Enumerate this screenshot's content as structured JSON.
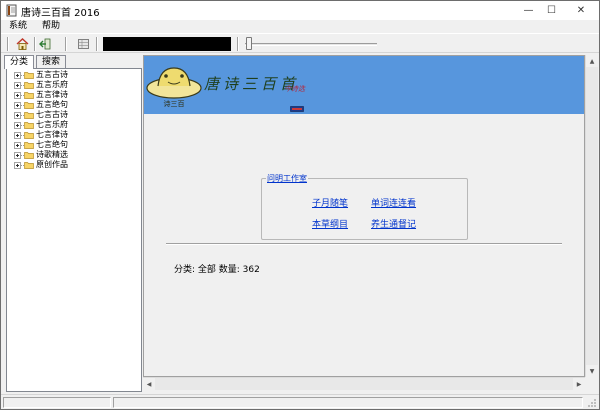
{
  "window": {
    "title": "唐诗三百首 2016",
    "minimize_glyph": "—",
    "maximize_glyph": "☐",
    "close_glyph": "✕"
  },
  "menu": {
    "items": [
      "系统",
      "帮助"
    ]
  },
  "toolbar": {
    "buttons": [
      "home-icon",
      "exit-icon",
      "grid-icon"
    ]
  },
  "left_panel": {
    "tabs": [
      "分类",
      "搜索"
    ],
    "active_tab": 0,
    "tree_items": [
      "五言古诗",
      "五言乐府",
      "五言律诗",
      "五言绝句",
      "七言古诗",
      "七言乐府",
      "七言律诗",
      "七言绝句",
      "诗歌精选",
      "原创作品"
    ]
  },
  "banner": {
    "title": "唐诗三百首",
    "subtitle": "今诗选",
    "hat_text": "诗三百"
  },
  "studio": {
    "label": "问明工作室",
    "links": [
      "子月随笔",
      "单词连连看",
      "本草纲目",
      "养生通督记"
    ]
  },
  "stats": {
    "text": "分类: 全部  数量: 362"
  },
  "colors": {
    "banner_bg": "#5796dd",
    "link": "#0033cc",
    "window_bg": "#f0f0f0"
  }
}
